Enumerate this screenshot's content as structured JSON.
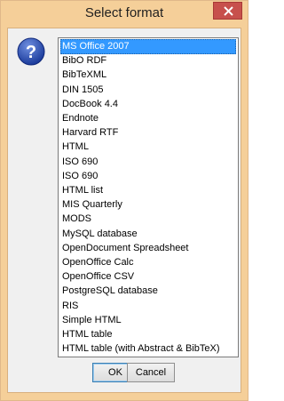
{
  "window": {
    "title": "Select format",
    "close_glyph": "×"
  },
  "icon": "question-icon",
  "list": {
    "selected_index": 0,
    "items": [
      "MS Office 2007",
      "BibO RDF",
      "BibTeXML",
      "DIN 1505",
      "DocBook 4.4",
      "Endnote",
      "Harvard RTF",
      "HTML",
      "ISO 690",
      "ISO 690",
      "HTML list",
      "MIS Quarterly",
      "MODS",
      "MySQL database",
      "OpenDocument Spreadsheet",
      "OpenOffice Calc",
      "OpenOffice CSV",
      "PostgreSQL database",
      "RIS",
      "Simple HTML",
      "HTML table",
      "HTML table (with Abstract & BibTeX)"
    ]
  },
  "buttons": {
    "ok_label": "OK",
    "cancel_label": "Cancel"
  },
  "colors": {
    "titlebar": "#f5cf99",
    "selection": "#3399ff",
    "close_button": "#c7504c"
  }
}
